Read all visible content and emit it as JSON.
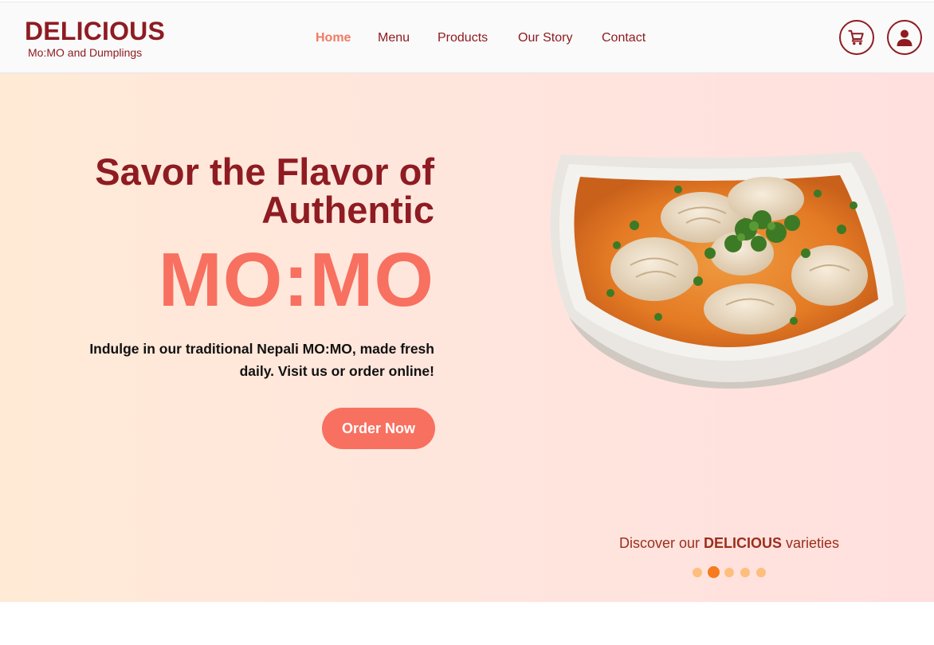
{
  "brand": {
    "title": "DELICIOUS",
    "subtitle": "Mo:MO and Dumplings"
  },
  "nav": {
    "items": [
      {
        "label": "Home",
        "active": true
      },
      {
        "label": "Menu",
        "active": false
      },
      {
        "label": "Products",
        "active": false
      },
      {
        "label": "Our Story",
        "active": false
      },
      {
        "label": "Contact",
        "active": false
      }
    ]
  },
  "header_icons": {
    "cart": "cart-icon",
    "account": "user-icon"
  },
  "hero": {
    "heading": "Savor the Flavor of Authentic",
    "highlight": "MO:MO",
    "description": "Indulge in our traditional Nepali MO:MO, made fresh daily. Visit us or order online!",
    "cta_label": "Order Now",
    "image_subject": "bowl of momo dumplings in orange curry soup with cilantro"
  },
  "carousel": {
    "caption_prefix": "Discover our ",
    "caption_brand": "DELICIOUS",
    "caption_suffix": " varieties",
    "slide_count": 5,
    "active_slide": 2
  },
  "colors": {
    "brand": "#8e1c22",
    "accent": "#f87060",
    "active_nav": "#f07a63",
    "dot_active": "#f57b1e",
    "dot_inactive": "#fdbf7f",
    "hero_gradient_start": "#ffead6",
    "hero_gradient_end": "#ffe0df"
  }
}
